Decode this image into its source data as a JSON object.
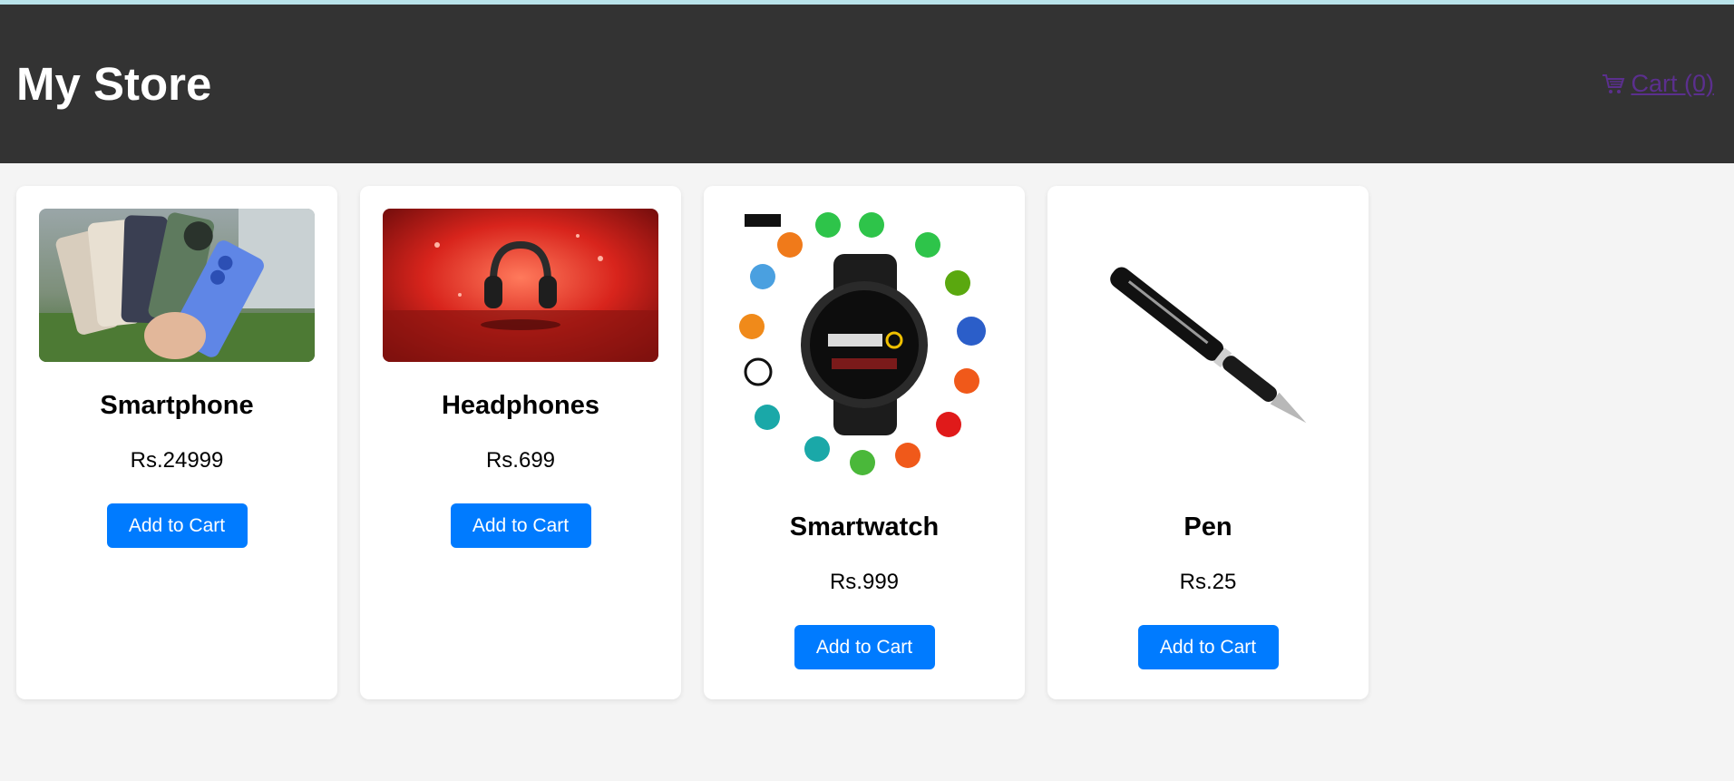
{
  "header": {
    "title": "My Store",
    "cart_label": " Cart (0)"
  },
  "products": [
    {
      "name": "Smartphone",
      "price": "Rs.24999",
      "button": "Add to Cart",
      "image_icon": "smartphone-image"
    },
    {
      "name": "Headphones",
      "price": "Rs.699",
      "button": "Add to Cart",
      "image_icon": "headphones-image"
    },
    {
      "name": "Smartwatch",
      "price": "Rs.999",
      "button": "Add to Cart",
      "image_icon": "smartwatch-image"
    },
    {
      "name": "Pen",
      "price": "Rs.25",
      "button": "Add to Cart",
      "image_icon": "pen-image"
    }
  ],
  "colors": {
    "header_bg": "#333333",
    "button_bg": "#007bff",
    "page_bg": "#f4f4f4",
    "link": "#5b2f8e"
  }
}
